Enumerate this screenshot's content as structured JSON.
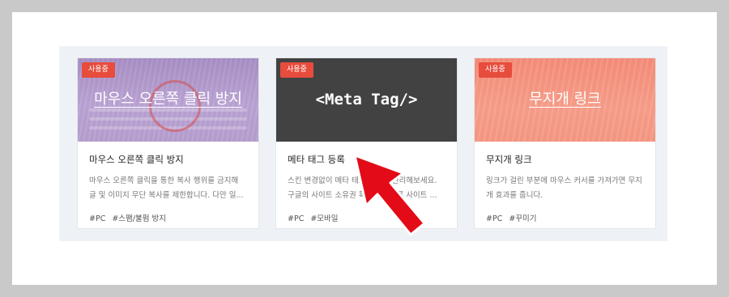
{
  "colors": {
    "badge": "#e74c3c",
    "arrow": "#e30b17",
    "panel_bg": "#eef2f6",
    "thumb_purple": "#b49ccd",
    "thumb_dark": "#424242",
    "thumb_coral": "#f39580"
  },
  "cards": [
    {
      "badge": "사용중",
      "thumb_text": "마우스 오른쪽 클릭 방지",
      "title": "마우스 오른쪽 클릭 방지",
      "desc": "마우스 오른쪽 클릭을 통한 복사 행위를 금지해 글 및 이미지 무단 복사를 제한합니다. 다만 일...",
      "tags": [
        "#PC",
        "#스팸/불펌 방지"
      ]
    },
    {
      "badge": "사용중",
      "thumb_text": "<Meta Tag/>",
      "title": "메타 태그 등록",
      "desc": "스킨 변경없이 메타 태그를 등록/관리해보세요. 구글의 사이트 소유권 확인이나 다른 사이트 ...",
      "tags": [
        "#PC",
        "#모바일"
      ]
    },
    {
      "badge": "사용중",
      "thumb_text": "무지개 링크",
      "title": "무지개 링크",
      "desc": "링크가 걸린 부분에 마우스 커서를 가져가면 무지개 효과를 줍니다.",
      "tags": [
        "#PC",
        "#꾸미기"
      ]
    }
  ],
  "arrow_icon": "red-arrow-pointer"
}
